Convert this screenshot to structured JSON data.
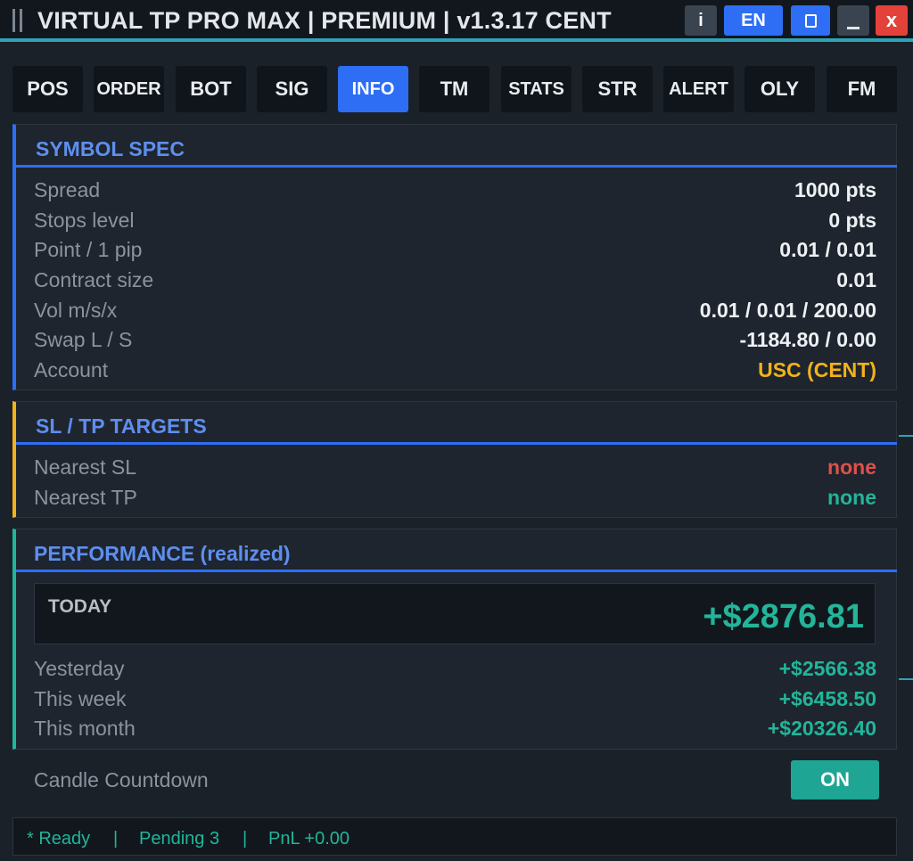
{
  "window": {
    "title": "VIRTUAL TP PRO MAX | PREMIUM | v1.3.17  CENT",
    "buttons": {
      "info": "i",
      "language": "EN",
      "close": "x"
    }
  },
  "tabs": [
    {
      "label": "POS"
    },
    {
      "label": "ORDER"
    },
    {
      "label": "BOT"
    },
    {
      "label": "SIG"
    },
    {
      "label": "INFO",
      "active": true
    },
    {
      "label": "TM"
    },
    {
      "label": "STATS"
    },
    {
      "label": "STR"
    },
    {
      "label": "ALERT"
    },
    {
      "label": "OLY"
    },
    {
      "label": "FM"
    }
  ],
  "symbol_spec": {
    "title": "SYMBOL SPEC",
    "rows": [
      {
        "label": "Spread",
        "value": "1000 pts"
      },
      {
        "label": "Stops level",
        "value": "0 pts"
      },
      {
        "label": "Point / 1 pip",
        "value": "0.01 / 0.01"
      },
      {
        "label": "Contract size",
        "value": "0.01"
      },
      {
        "label": "Vol m/s/x",
        "value": "0.01 / 0.01 / 200.00"
      },
      {
        "label": "Swap L / S",
        "value": "-1184.80 / 0.00"
      },
      {
        "label": "Account",
        "value": "USC (CENT)"
      }
    ]
  },
  "sl_tp": {
    "title": "SL / TP TARGETS",
    "rows": [
      {
        "label": "Nearest SL",
        "value": "none"
      },
      {
        "label": "Nearest TP",
        "value": "none"
      }
    ]
  },
  "performance": {
    "title": "PERFORMANCE (realized)",
    "today_label": "TODAY",
    "today_value": "+$2876.81",
    "rows": [
      {
        "label": "Yesterday",
        "value": "+$2566.38"
      },
      {
        "label": "This week",
        "value": "+$6458.50"
      },
      {
        "label": "This month",
        "value": "+$20326.40"
      }
    ]
  },
  "candle_countdown": {
    "label": "Candle Countdown",
    "toggle": "ON"
  },
  "status": {
    "ready": "* Ready",
    "sep": "|",
    "pending": "Pending 3",
    "pnl": "PnL +0.00"
  },
  "colors": {
    "accent_blue": "#2d6ef5",
    "positive": "#22b59a",
    "negative": "#e0504a",
    "gold": "#f2b21b"
  }
}
